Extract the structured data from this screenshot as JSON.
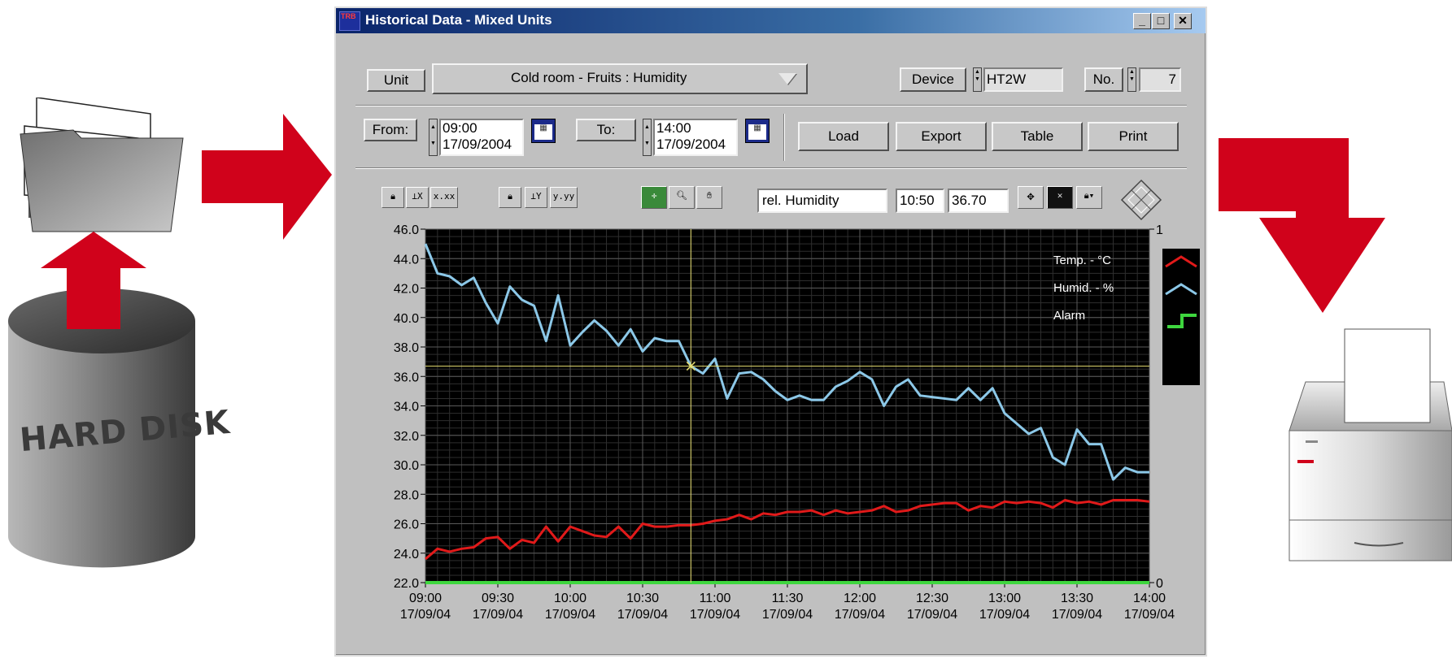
{
  "window": {
    "title": "Historical Data - Mixed Units",
    "app_icon_text": "TRB",
    "minimize": "_",
    "maximize": "□",
    "close": "✕"
  },
  "controls": {
    "unit_button": "Unit",
    "unit_value": "Cold room - Fruits : Humidity",
    "device_button": "Device",
    "device_value": "HT2W",
    "no_button": "No.",
    "no_value": "7",
    "from_button": "From:",
    "from_time": "09:00",
    "from_date": "17/09/2004",
    "to_button": "To:",
    "to_time": "14:00",
    "to_date": "17/09/2004",
    "load": "Load",
    "export": "Export",
    "table": "Table",
    "print": "Print"
  },
  "toolbar": {
    "x_format": "x.xx",
    "y_format": "y.yy",
    "cursor_name": "rel. Humidity",
    "cursor_x": "10:50",
    "cursor_y": "36.70"
  },
  "left_graphic": {
    "disk_label": "HARD DISK"
  },
  "colors": {
    "temp": "#e11a1a",
    "humid": "#8cc8e8",
    "alarm": "#3ed63e",
    "cursor": "#e8e070",
    "arrow": "#d0021b"
  },
  "chart_data": {
    "type": "line",
    "ylim": [
      22.0,
      46.0
    ],
    "y_ticks": [
      "46.0",
      "44.0",
      "42.0",
      "40.0",
      "38.0",
      "36.0",
      "34.0",
      "32.0",
      "30.0",
      "28.0",
      "26.0",
      "24.0",
      "22.0"
    ],
    "x_ticks": [
      {
        "time": "09:00",
        "date": "17/09/04"
      },
      {
        "time": "09:30",
        "date": "17/09/04"
      },
      {
        "time": "10:00",
        "date": "17/09/04"
      },
      {
        "time": "10:30",
        "date": "17/09/04"
      },
      {
        "time": "11:00",
        "date": "17/09/04"
      },
      {
        "time": "11:30",
        "date": "17/09/04"
      },
      {
        "time": "12:00",
        "date": "17/09/04"
      },
      {
        "time": "12:30",
        "date": "17/09/04"
      },
      {
        "time": "13:00",
        "date": "17/09/04"
      },
      {
        "time": "13:30",
        "date": "17/09/04"
      },
      {
        "time": "14:00",
        "date": "17/09/04"
      }
    ],
    "right_axis": [
      "1",
      "0"
    ],
    "cursor": {
      "x": "10:50",
      "y": 36.7
    },
    "series": [
      {
        "name": "Temp. - °C",
        "color": "#e11a1a",
        "x": [
          "09:00",
          "09:05",
          "09:10",
          "09:15",
          "09:20",
          "09:25",
          "09:30",
          "09:35",
          "09:40",
          "09:45",
          "09:50",
          "09:55",
          "10:00",
          "10:05",
          "10:10",
          "10:15",
          "10:20",
          "10:25",
          "10:30",
          "10:35",
          "10:40",
          "10:45",
          "10:50",
          "10:55",
          "11:00",
          "11:05",
          "11:10",
          "11:15",
          "11:20",
          "11:25",
          "11:30",
          "11:35",
          "11:40",
          "11:45",
          "11:50",
          "11:55",
          "12:00",
          "12:05",
          "12:10",
          "12:15",
          "12:20",
          "12:25",
          "12:30",
          "12:35",
          "12:40",
          "12:45",
          "12:50",
          "12:55",
          "13:00",
          "13:05",
          "13:10",
          "13:15",
          "13:20",
          "13:25",
          "13:30",
          "13:35",
          "13:40",
          "13:45",
          "13:50",
          "13:55",
          "14:00"
        ],
        "values": [
          23.6,
          24.3,
          24.1,
          24.3,
          24.4,
          25.0,
          25.1,
          24.3,
          24.9,
          24.7,
          25.8,
          24.8,
          25.8,
          25.5,
          25.2,
          25.1,
          25.8,
          25.0,
          26.0,
          25.8,
          25.8,
          25.9,
          25.9,
          26.0,
          26.2,
          26.3,
          26.6,
          26.3,
          26.7,
          26.6,
          26.8,
          26.8,
          26.9,
          26.6,
          26.9,
          26.7,
          26.8,
          26.9,
          27.2,
          26.8,
          26.9,
          27.2,
          27.3,
          27.4,
          27.4,
          26.9,
          27.2,
          27.1,
          27.5,
          27.4,
          27.5,
          27.4,
          27.1,
          27.6,
          27.4,
          27.5,
          27.3,
          27.6,
          27.6,
          27.6,
          27.5
        ]
      },
      {
        "name": "Humid. - %",
        "color": "#8cc8e8",
        "x": [
          "09:00",
          "09:05",
          "09:10",
          "09:15",
          "09:20",
          "09:25",
          "09:30",
          "09:35",
          "09:40",
          "09:45",
          "09:50",
          "09:55",
          "10:00",
          "10:05",
          "10:10",
          "10:15",
          "10:20",
          "10:25",
          "10:30",
          "10:35",
          "10:40",
          "10:45",
          "10:50",
          "10:55",
          "11:00",
          "11:05",
          "11:10",
          "11:15",
          "11:20",
          "11:25",
          "11:30",
          "11:35",
          "11:40",
          "11:45",
          "11:50",
          "11:55",
          "12:00",
          "12:05",
          "12:10",
          "12:15",
          "12:20",
          "12:25",
          "12:30",
          "12:35",
          "12:40",
          "12:45",
          "12:50",
          "12:55",
          "13:00",
          "13:05",
          "13:10",
          "13:15",
          "13:20",
          "13:25",
          "13:30",
          "13:35",
          "13:40",
          "13:45",
          "13:50",
          "13:55",
          "14:00"
        ],
        "values": [
          45.0,
          43.0,
          42.8,
          42.2,
          42.7,
          41.0,
          39.6,
          42.1,
          41.2,
          40.8,
          38.4,
          41.5,
          38.1,
          39.0,
          39.8,
          39.1,
          38.1,
          39.2,
          37.7,
          38.6,
          38.4,
          38.4,
          36.7,
          36.2,
          37.2,
          34.5,
          36.2,
          36.3,
          35.8,
          35.0,
          34.4,
          34.7,
          34.4,
          34.4,
          35.3,
          35.7,
          36.3,
          35.8,
          34.0,
          35.3,
          35.8,
          34.7,
          34.6,
          34.5,
          34.4,
          35.2,
          34.4,
          35.2,
          33.5,
          32.8,
          32.1,
          32.5,
          30.5,
          30.0,
          32.4,
          31.4,
          31.4,
          29.0,
          29.8,
          29.5,
          29.5
        ]
      },
      {
        "name": "Alarm",
        "color": "#3ed63e",
        "x": [
          "09:00",
          "14:00"
        ],
        "values": [
          22.0,
          22.0
        ]
      }
    ],
    "legend": "top-right"
  }
}
